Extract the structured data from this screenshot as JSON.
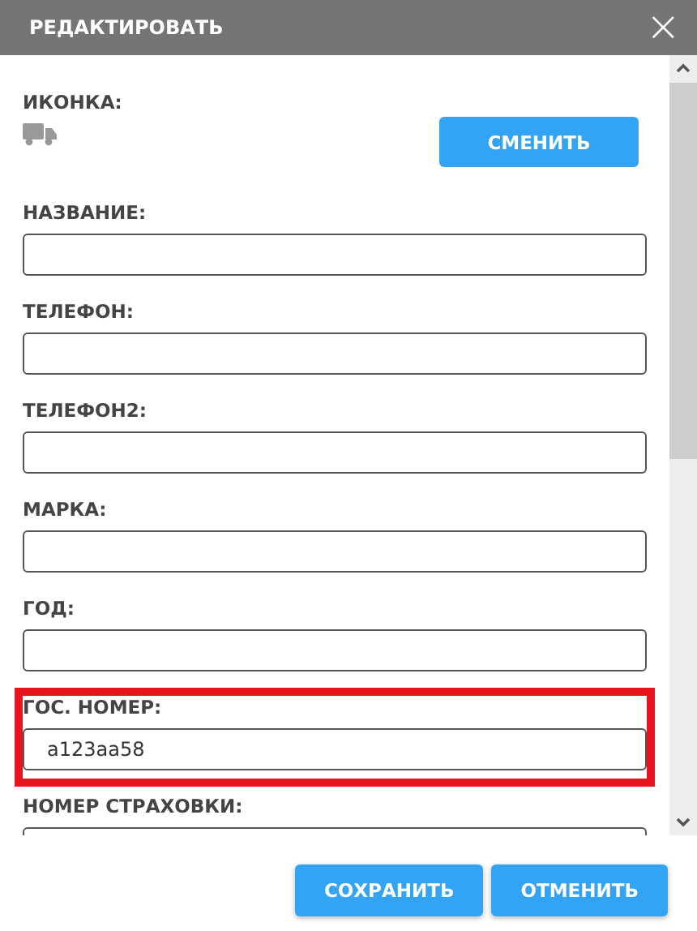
{
  "window": {
    "title": "РЕДАКТИРОВАТЬ",
    "close": "×"
  },
  "icon_section": {
    "label": "ИКОНКА:",
    "button": "СМЕНИТЬ"
  },
  "fields": [
    {
      "label": "НАЗВАНИЕ:",
      "highlighted": false
    },
    {
      "label": "ТЕЛЕФОН:",
      "highlighted": false
    },
    {
      "label": "ТЕЛЕФОН2:",
      "highlighted": false
    },
    {
      "label": "МАРКА:",
      "highlighted": false
    },
    {
      "label": "ГОД:",
      "highlighted": false
    },
    {
      "label": "ГОС. НОМЕР:",
      "value": "a123aa58",
      "highlighted": true
    },
    {
      "label": "НОМЕР СТРАХОВКИ:",
      "highlighted": false
    }
  ],
  "buttons": [
    "СОХРАНИТЬ",
    "ОТМЕНИТЬ"
  ]
}
